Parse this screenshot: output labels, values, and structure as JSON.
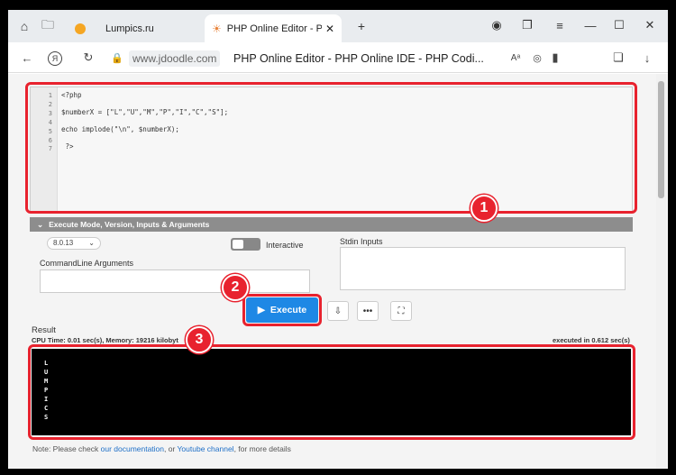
{
  "browser": {
    "tabs": [
      {
        "label": "Lumpics.ru"
      },
      {
        "label": "PHP Online Editor - PHP"
      }
    ],
    "url": "www.jdoodle.com",
    "page_title": "PHP Online Editor - PHP Online IDE - PHP Codi..."
  },
  "editor": {
    "line_numbers": [
      "1",
      "2",
      "3",
      "4",
      "5",
      "6",
      "7"
    ],
    "code_lines": [
      "<?php",
      "",
      "$numberX = [\"L\",\"U\",\"M\",\"P\",\"I\",\"C\",\"S\"];",
      "",
      "echo implode(\"\\n\", $numberX);",
      "",
      " ?>"
    ]
  },
  "settings": {
    "section_title": "Execute Mode, Version, Inputs & Arguments",
    "version": "8.0.13",
    "interactive_label": "Interactive",
    "stdin_label": "Stdin Inputs",
    "cmdline_label": "CommandLine Arguments"
  },
  "actions": {
    "execute_label": "Execute"
  },
  "result": {
    "label": "Result",
    "stats": "CPU Time: 0.01 sec(s), Memory: 19216 kilobyt",
    "executed": "executed in 0.612 sec(s)",
    "output_lines": [
      "L",
      "U",
      "M",
      "P",
      "I",
      "C",
      "S"
    ]
  },
  "note": {
    "prefix": "Note: Please check ",
    "link1": "our documentation",
    "middle": ", or ",
    "link2": "Youtube channel",
    "suffix": ", for more details"
  },
  "annotations": {
    "badges": [
      "1",
      "2",
      "3"
    ],
    "mark_color": "#e8222e"
  },
  "colors": {
    "execute_bg": "#1e88e5",
    "console_bg": "#000000"
  }
}
